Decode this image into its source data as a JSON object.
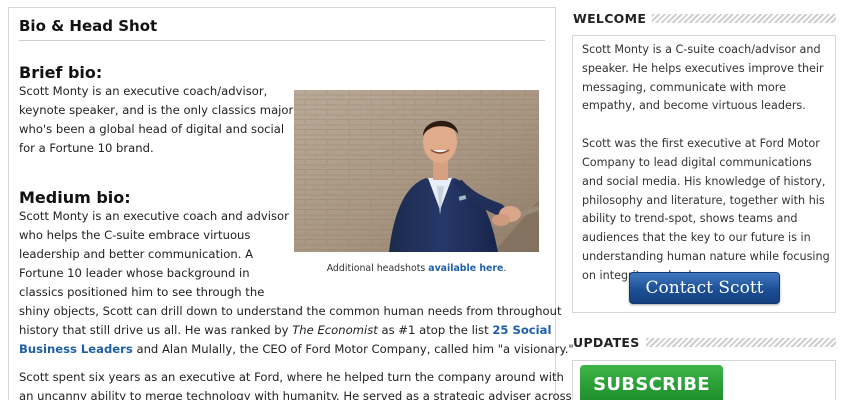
{
  "main": {
    "title": "Bio & Head Shot",
    "brief": {
      "heading": "Brief bio:",
      "lines": [
        "Scott Monty is an executive coach/advisor,",
        "keynote speaker, and is the only classics major",
        "who's been a global head of digital and social",
        "for a Fortune 10 brand."
      ]
    },
    "medium": {
      "heading": "Medium bio:",
      "lines": [
        "Scott Monty is an executive coach and advisor",
        "who helps the C-suite embrace virtuous",
        "leadership and better communication. A",
        "Fortune 10 leader whose background in",
        "classics positioned him to see through the",
        "shiny objects, Scott can drill down to understand the common human needs from throughout",
        "history that still drive us all. He was ranked by "
      ],
      "economist": "The Economist",
      "after_economist": " as #1 atop the list ",
      "link_line1": "25 Social",
      "link_line2": "Business Leaders",
      "after_link": " and Alan Mulally, the CEO of Ford Motor Company, called him \"a visionary.\""
    },
    "para3": {
      "lines": [
        "Scott spent six years as an executive at Ford, where he helped turn the company around with",
        "an uncanny ability to merge technology with humanity. He served as a strategic adviser across"
      ]
    },
    "caption": {
      "text": "Additional headshots ",
      "link": "available here",
      "suffix": "."
    }
  },
  "sidebar": {
    "welcome_heading": "WELCOME",
    "welcome_lines_1": [
      "Scott Monty is a C-suite coach/advisor and",
      "speaker. He helps executives improve their",
      "messaging, communicate with more",
      "empathy, and become virtuous leaders."
    ],
    "welcome_lines_2": [
      "Scott was the first executive at Ford Motor",
      "Company to lead digital communications",
      "and social media. His knowledge of history,",
      "philosophy and literature, together with his",
      "ability to trend-spot, shows teams and",
      "audiences that the key to our future is in",
      "understanding human nature while focusing",
      "on integrity and values."
    ],
    "contact_label": "Contact Scott",
    "updates_heading": "UPDATES",
    "subscribe_label": "SUBSCRIBE"
  }
}
